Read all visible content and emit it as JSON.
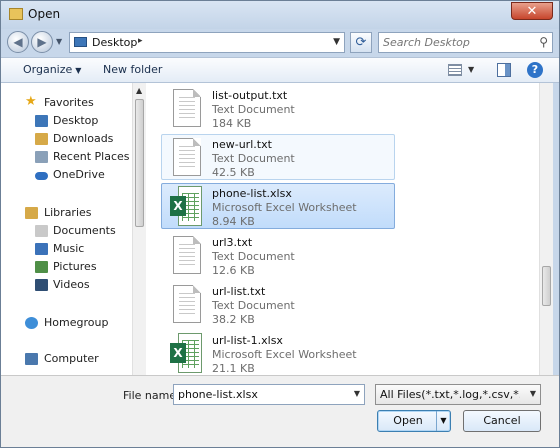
{
  "window": {
    "title": "Open",
    "close_glyph": "✕"
  },
  "nav": {
    "back_glyph": "◀",
    "forward_glyph": "▶",
    "address": "Desktop",
    "address_arrow": "▸",
    "refresh_glyph": "⟳",
    "search_placeholder": "Search Desktop",
    "search_glyph": "⚲"
  },
  "toolbar": {
    "organize": "Organize",
    "new_folder": "New folder",
    "help_glyph": "?"
  },
  "sidebar": {
    "items": [
      {
        "label": "Favorites",
        "icon": "star-icon",
        "color": "#e6a817",
        "group": true
      },
      {
        "label": "Desktop",
        "icon": "desktop-icon",
        "color": "#3d76b8"
      },
      {
        "label": "Downloads",
        "icon": "downloads-icon",
        "color": "#d6a948"
      },
      {
        "label": "Recent Places",
        "icon": "recent-places-icon",
        "color": "#8aa0b8"
      },
      {
        "label": "OneDrive",
        "icon": "onedrive-icon",
        "color": "#2f6fc1"
      },
      {
        "label": "Libraries",
        "icon": "libraries-icon",
        "color": "#d6a948",
        "group": true
      },
      {
        "label": "Documents",
        "icon": "documents-icon",
        "color": "#c9c9c9"
      },
      {
        "label": "Music",
        "icon": "music-icon",
        "color": "#3b72b9"
      },
      {
        "label": "Pictures",
        "icon": "pictures-icon",
        "color": "#4f8f47"
      },
      {
        "label": "Videos",
        "icon": "videos-icon",
        "color": "#2f4e73"
      },
      {
        "label": "Homegroup",
        "icon": "homegroup-icon",
        "color": "#3e8ed8",
        "group": true
      },
      {
        "label": "Computer",
        "icon": "computer-icon",
        "color": "#4a78ad",
        "group": true
      }
    ]
  },
  "files": [
    {
      "name": "list-output.txt",
      "type": "Text Document",
      "size": "184 KB",
      "icon": "text-document-icon",
      "state": "normal"
    },
    {
      "name": "new-url.txt",
      "type": "Text Document",
      "size": "42.5 KB",
      "icon": "text-document-icon",
      "state": "hover"
    },
    {
      "name": "phone-list.xlsx",
      "type": "Microsoft Excel Worksheet",
      "size": "8.94 KB",
      "icon": "excel-worksheet-icon",
      "state": "selected"
    },
    {
      "name": "url3.txt",
      "type": "Text Document",
      "size": "12.6 KB",
      "icon": "text-document-icon",
      "state": "normal"
    },
    {
      "name": "url-list.txt",
      "type": "Text Document",
      "size": "38.2 KB",
      "icon": "text-document-icon",
      "state": "normal"
    },
    {
      "name": "url-list-1.xlsx",
      "type": "Microsoft Excel Worksheet",
      "size": "21.1 KB",
      "icon": "excel-worksheet-icon",
      "state": "normal"
    }
  ],
  "bottom": {
    "file_name_label": "File name:",
    "file_name_value": "phone-list.xlsx",
    "file_type_filter": "All Files(*.txt,*.log,*.csv,*.xls,*.xl",
    "open_button": "Open",
    "cancel_button": "Cancel"
  }
}
